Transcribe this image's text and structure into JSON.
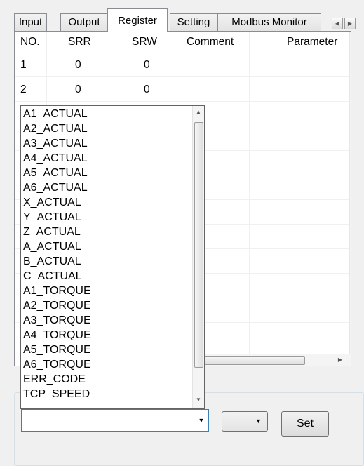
{
  "tabs": [
    {
      "label": "Input",
      "active": false
    },
    {
      "label": "Output",
      "active": false
    },
    {
      "label": "Register",
      "active": true
    },
    {
      "label": "Setting",
      "active": false
    },
    {
      "label": "Modbus Monitor",
      "active": false
    }
  ],
  "tab_scroll": {
    "left_icon": "arrow-left-icon",
    "right_icon": "arrow-right-icon"
  },
  "grid": {
    "columns": [
      "NO.",
      "SRR",
      "SRW",
      "Comment",
      "Parameter"
    ],
    "rows": [
      {
        "no": "1",
        "srr": "0",
        "srw": "0",
        "comment": "",
        "parameter": ""
      },
      {
        "no": "2",
        "srr": "0",
        "srw": "0",
        "comment": "",
        "parameter": ""
      }
    ]
  },
  "dropdown_list": {
    "items": [
      "A1_ACTUAL",
      "A2_ACTUAL",
      "A3_ACTUAL",
      "A4_ACTUAL",
      "A5_ACTUAL",
      "A6_ACTUAL",
      "X_ACTUAL",
      "Y_ACTUAL",
      "Z_ACTUAL",
      "A_ACTUAL",
      "B_ACTUAL",
      "C_ACTUAL",
      "A1_TORQUE",
      "A2_TORQUE",
      "A3_TORQUE",
      "A4_TORQUE",
      "A5_TORQUE",
      "A6_TORQUE",
      "ERR_CODE",
      "TCP_SPEED"
    ]
  },
  "bottom": {
    "parameter_combo_value": "",
    "small_combo_value": "",
    "set_label": "Set"
  },
  "colors": {
    "accent_border": "#3c7fb1",
    "tab_border": "#898c95"
  }
}
